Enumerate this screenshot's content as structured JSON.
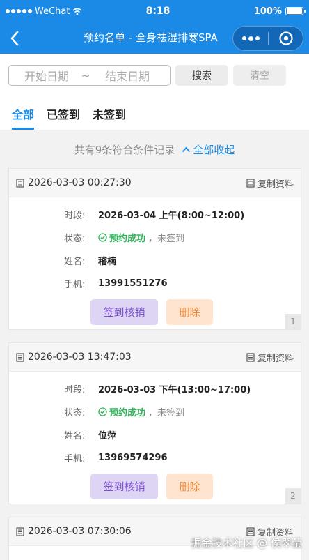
{
  "status_bar": {
    "carrier": "WeChat",
    "time": "8:18",
    "battery": "100%"
  },
  "nav": {
    "title": "预约名单 - 全身祛湿排寒SPA"
  },
  "search": {
    "start_placeholder": "开始日期",
    "separator": "~",
    "end_placeholder": "结束日期",
    "search_label": "搜索",
    "clear_label": "清空"
  },
  "tabs": [
    {
      "label": "全部",
      "active": true
    },
    {
      "label": "已签到"
    },
    {
      "label": "未签到"
    }
  ],
  "summary": {
    "text": "共有9条符合条件记录",
    "collapse": "全部收起"
  },
  "labels": {
    "period": "时段:",
    "status": "状态:",
    "name": "姓名:",
    "phone": "手机:",
    "copy": "复制资料",
    "checkin": "签到核销",
    "delete": "删除"
  },
  "records": [
    {
      "created": "2026-03-03 00:27:30",
      "period": "2026-03-04 上午(8:00~12:00)",
      "status": "预约成功",
      "sign": "，未签到",
      "name": "稽楠",
      "phone": "13991551276",
      "index": "1"
    },
    {
      "created": "2026-03-03 13:47:03",
      "period": "2026-03-03 下午(13:00~17:00)",
      "status": "预约成功",
      "sign": "，未签到",
      "name": "位萍",
      "phone": "13969574296",
      "index": "2"
    },
    {
      "created": "2026-03-03 07:30:06"
    }
  ],
  "watermark": "掘金技术社区 @ 侯翠莹",
  "colors": {
    "primary": "#1b8ae6",
    "success": "#2fb35a",
    "checkin_bg": "#ded5f4",
    "delete_bg": "#ffe5cf"
  }
}
